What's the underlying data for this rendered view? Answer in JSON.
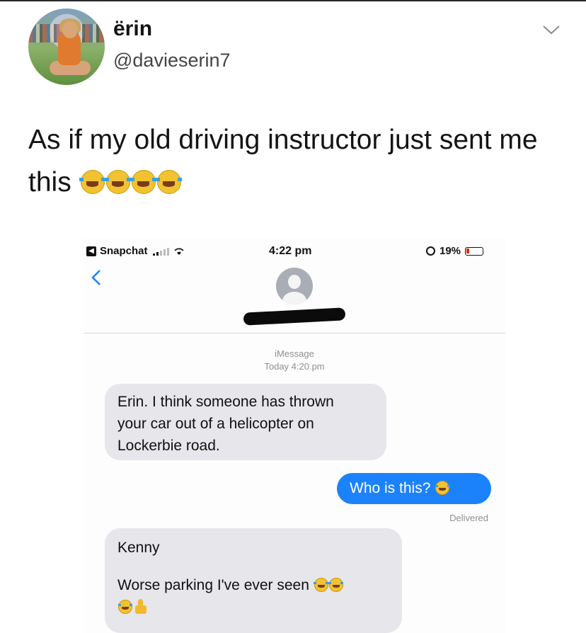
{
  "tweet": {
    "display_name": "ërin",
    "handle": "@davieserin7",
    "text": "As if my old driving instructor just sent me this",
    "emojis": [
      "face-with-tears-of-joy",
      "face-with-tears-of-joy",
      "face-with-tears-of-joy",
      "face-with-tears-of-joy"
    ],
    "menu_icon": "chevron-down-icon"
  },
  "phone_screenshot": {
    "status_bar": {
      "back_app": "Snapchat",
      "time": "4:22 pm",
      "battery": "19%"
    },
    "conversation_meta": {
      "service": "iMessage",
      "timestamp": "Today 4:20 pm"
    },
    "messages": [
      {
        "direction": "incoming",
        "lines": [
          "Erin. I think someone has thrown",
          "your car out of a helicopter on",
          "Lockerbie road."
        ]
      },
      {
        "direction": "outgoing",
        "text": "Who is this?",
        "emojis": [
          "face-with-tears-of-joy"
        ]
      },
      {
        "direction": "incoming",
        "lines": [
          "Kenny",
          "Worse parking I've ever seen"
        ],
        "emojis": [
          "face-with-tears-of-joy",
          "face-with-tears-of-joy",
          "face-with-tears-of-joy",
          "thumbs-up"
        ]
      }
    ],
    "delivery_status": "Delivered",
    "colors": {
      "outgoing_bubble": "#1b82fb",
      "incoming_bubble": "#e6e6eb"
    }
  }
}
